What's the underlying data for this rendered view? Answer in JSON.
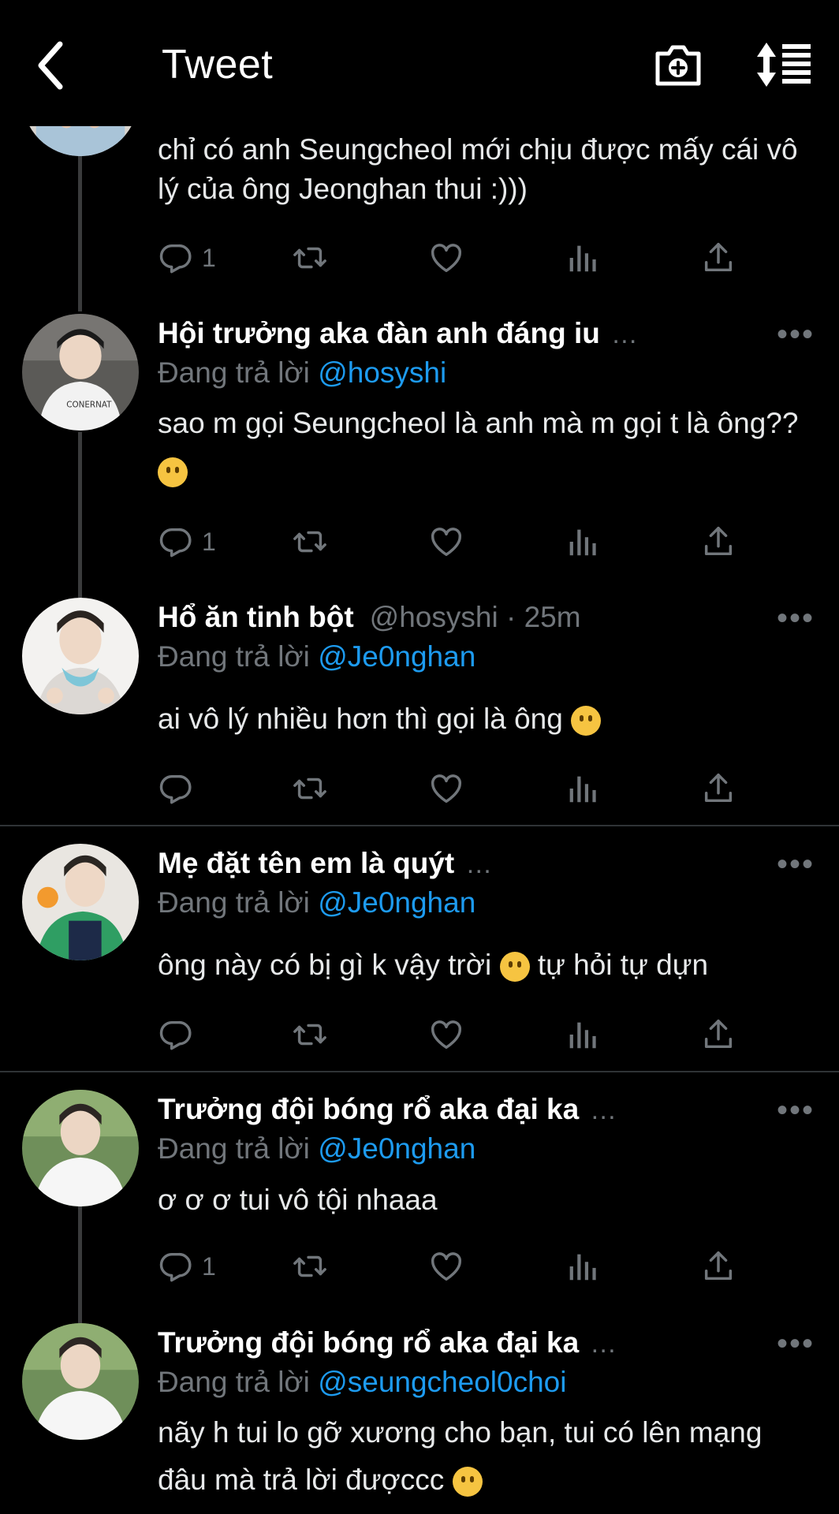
{
  "header": {
    "title": "Tweet"
  },
  "tweets": [
    {
      "text": "chỉ có anh Seungcheol mới chịu được mấy cái vô lý của ông Jeonghan thui :)))",
      "reply_count": "1"
    },
    {
      "display_name": "Hội trưởng aka đàn anh đáng iu",
      "reply_prefix": "Đang trả lời",
      "reply_handle": "@hosyshi",
      "text": "sao m gọi Seungcheol là anh mà m gọi t là ông??",
      "reply_count": "1"
    },
    {
      "display_name": "Hổ ăn tinh bột",
      "handle": "@hosyshi · 25m",
      "reply_prefix": "Đang trả lời",
      "reply_handle": "@Je0nghan",
      "text": "ai vô lý nhiều hơn thì gọi là ông",
      "reply_count": ""
    },
    {
      "display_name": "Mẹ đặt tên em là quýt",
      "reply_prefix": "Đang trả lời",
      "reply_handle": "@Je0nghan",
      "text_a": "ông này có bị gì k vậy trời",
      "text_b": "tự hỏi tự dựn",
      "reply_count": ""
    },
    {
      "display_name": "Trưởng đội bóng rổ aka đại ka",
      "reply_prefix": "Đang trả lời",
      "reply_handle": "@Je0nghan",
      "text": "ơ ơ ơ tui vô tội nhaaa",
      "reply_count": "1"
    },
    {
      "display_name": "Trưởng đội bóng rổ aka đại ka",
      "reply_prefix": "Đang trả lời",
      "reply_handle": "@seungcheol0choi",
      "text": "nãy h tui lo gỡ xương cho bạn, tui có lên mạng đâu mà trả lời đượccc"
    }
  ],
  "icons": [
    "back-arrow-icon",
    "camera-add-icon",
    "sort-icon",
    "reply-icon",
    "retweet-icon",
    "like-icon",
    "analytics-icon",
    "share-icon",
    "more-icon"
  ],
  "colors": {
    "background": "#000000",
    "link": "#1d9bf0",
    "muted": "#71767b",
    "text": "#e7e9ea"
  }
}
